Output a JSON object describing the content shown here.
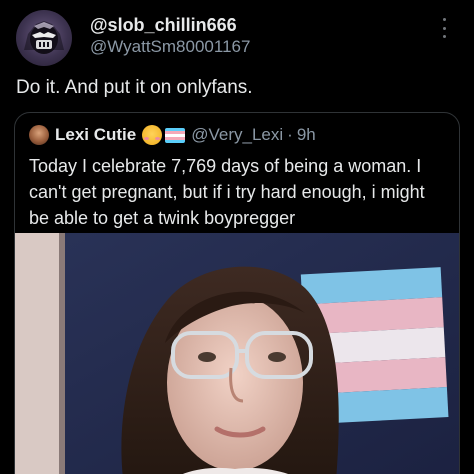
{
  "post": {
    "author": {
      "display_name": "@slob_chillin666",
      "handle": "@WyattSm80001167",
      "avatar_icon": "gorilla-avatar-icon"
    },
    "more_icon": "more-options-icon",
    "text": "Do it. And put it on onlyfans."
  },
  "quote": {
    "author": {
      "display_name": "Lexi Cutie",
      "emojis": [
        "smiling-face-with-hearts-emoji",
        "transgender-flag-emoji"
      ],
      "handle": "@Very_Lexi",
      "separator": "·",
      "time": "9h"
    },
    "text_lines": [
      "Today I celebrate 7,769 days of being a woman. I",
      "can't get pregnant, but if i try hard enough, i might",
      "be able to get a twink boypregger"
    ],
    "photo": "selfie-photo"
  },
  "colors": {
    "background": "#000000",
    "text": "#e7e9ea",
    "secondary_text": "#8b98a5",
    "border": "#2f3336",
    "flag_blue": "#5bcefa",
    "flag_pink": "#f5a9b8",
    "flag_white": "#ffffff"
  }
}
